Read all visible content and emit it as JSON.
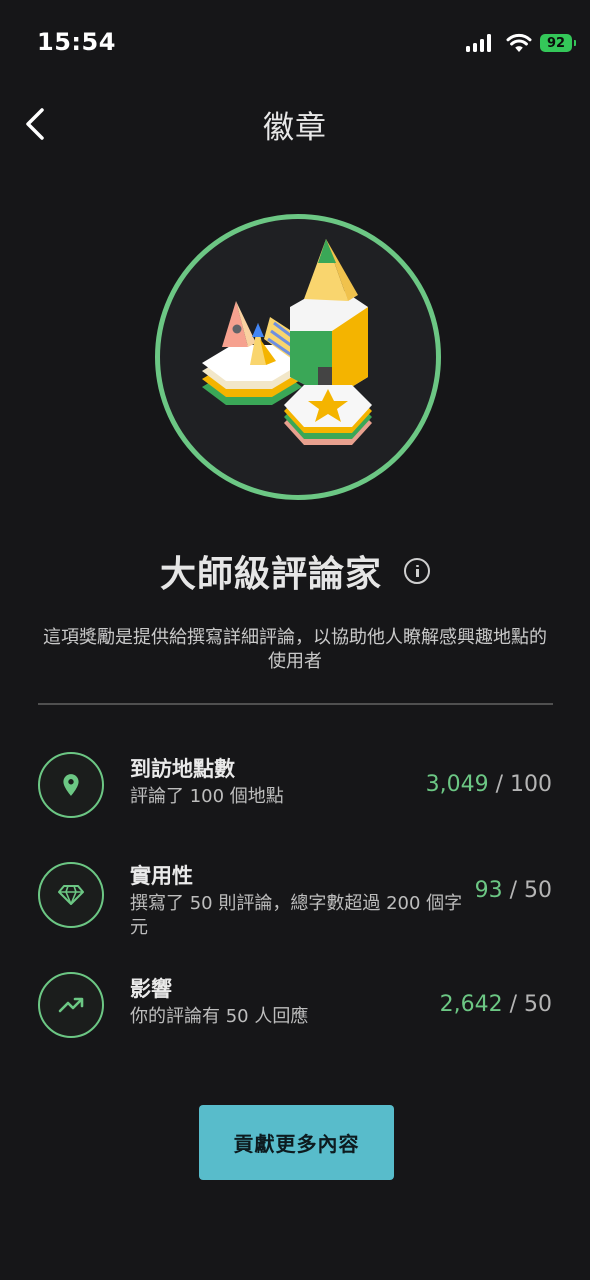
{
  "status_bar": {
    "time": "15:54",
    "battery": "92"
  },
  "header": {
    "title": "徽章"
  },
  "badge": {
    "name": "大師級評論家",
    "description": "這項獎勵是提供給撰寫詳細評論，以協助他人瞭解感興趣地點的使用者"
  },
  "requirements": [
    {
      "icon": "location-pin-icon",
      "title": "到訪地點數",
      "desc": "評論了 100 個地點",
      "current": "3,049",
      "separator": " / ",
      "target": "100"
    },
    {
      "icon": "diamond-icon",
      "title": "實用性",
      "desc": "撰寫了 50 則評論，總字數超過 200 個字元",
      "current": "93",
      "separator": " / ",
      "target": "50"
    },
    {
      "icon": "trending-up-icon",
      "title": "影響",
      "desc": "你的評論有 50 人回應",
      "current": "2,642",
      "separator": " / ",
      "target": "50"
    }
  ],
  "actions": {
    "contribute_label": "貢獻更多內容"
  },
  "colors": {
    "accent_green": "#6cc784",
    "button_teal": "#58bccb",
    "background": "#161618"
  }
}
